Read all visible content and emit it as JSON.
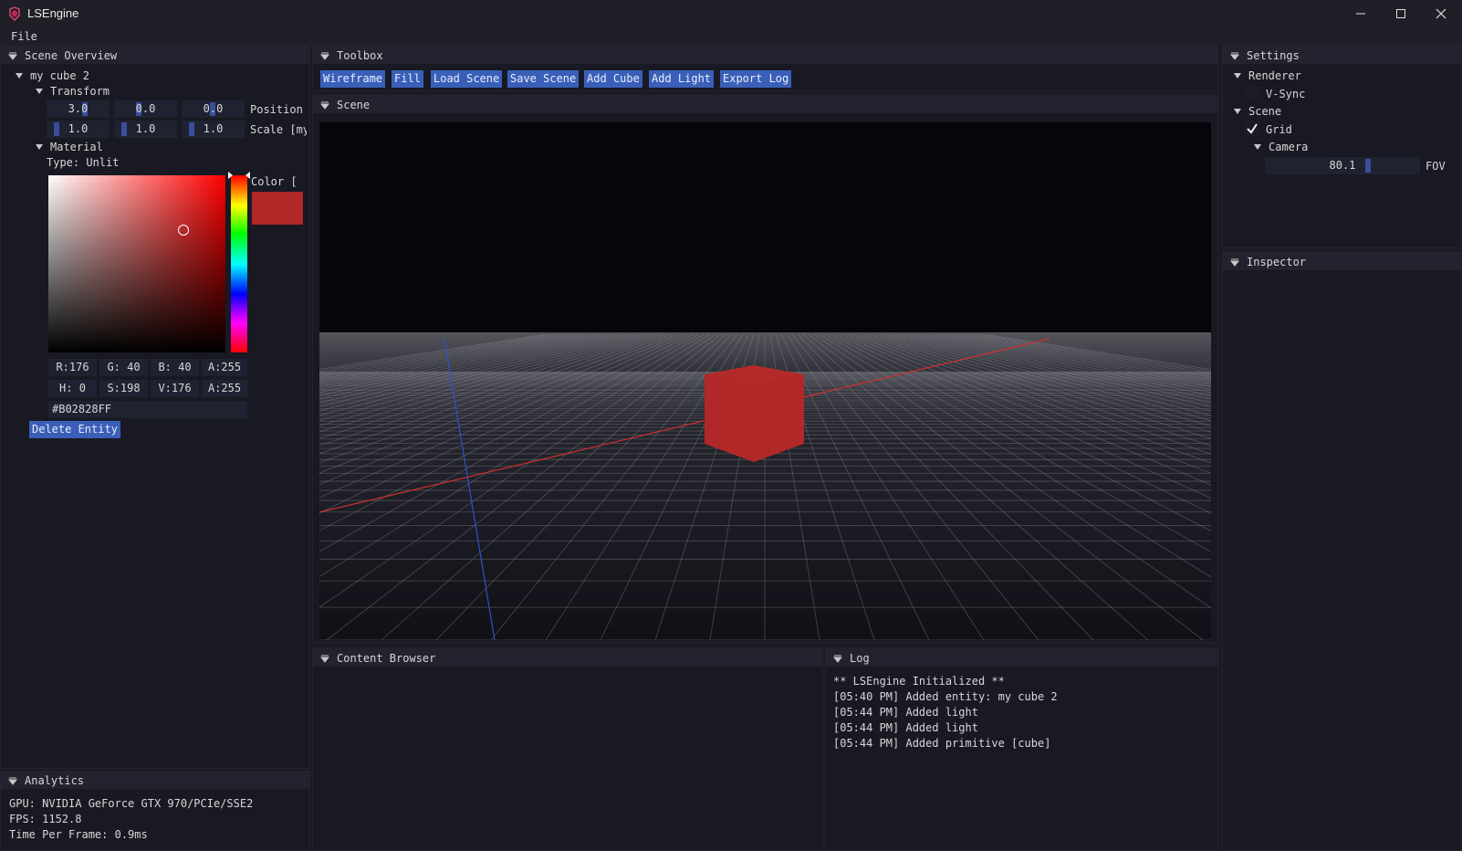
{
  "window": {
    "title": "LSEngine"
  },
  "menu": {
    "file": "File"
  },
  "scene_overview": {
    "title": "Scene Overview",
    "entity": "my cube 2",
    "transform_label": "Transform",
    "position": {
      "x": "3.0",
      "y": "0.0",
      "z": "0.0",
      "label": "Position"
    },
    "scale": {
      "x": "1.0",
      "y": "1.0",
      "z": "1.0",
      "label": "Scale [my"
    },
    "material_label": "Material",
    "material_type": "Type: Unlit",
    "color_label": "Color [",
    "color_hex_value": "#B02828",
    "rgba": {
      "r": "R:176",
      "g": "G: 40",
      "b": "B: 40",
      "a": "A:255"
    },
    "hsva": {
      "h": "H:  0",
      "s": "S:198",
      "v": "V:176",
      "a": "A:255"
    },
    "hex": "#B02828FF",
    "delete_button": "Delete Entity"
  },
  "analytics": {
    "title": "Analytics",
    "gpu": "GPU: NVIDIA GeForce GTX 970/PCIe/SSE2",
    "fps": "FPS: 1152.8",
    "frame_time": "Time Per Frame: 0.9ms"
  },
  "toolbox": {
    "title": "Toolbox",
    "buttons": [
      "Wireframe",
      "Fill",
      "Load Scene",
      "Save Scene",
      "Add Cube",
      "Add Light",
      "Export Log"
    ]
  },
  "scene": {
    "title": "Scene"
  },
  "content_browser": {
    "title": "Content Browser"
  },
  "log": {
    "title": "Log",
    "lines": [
      "** LSEngine Initialized **",
      "[05:40 PM] Added entity: my cube 2",
      "[05:44 PM] Added light",
      "[05:44 PM] Added light",
      "[05:44 PM] Added primitive [cube]"
    ]
  },
  "settings": {
    "title": "Settings",
    "renderer": "Renderer",
    "vsync": "V-Sync",
    "vsync_checked": false,
    "scene": "Scene",
    "grid": "Grid",
    "grid_checked": true,
    "camera": "Camera",
    "fov_value": "80.1",
    "fov_label": "FOV"
  },
  "inspector": {
    "title": "Inspector"
  },
  "colors": {
    "accent": "#3a5fb8",
    "cube": "#B02828",
    "bg": "#181922"
  }
}
